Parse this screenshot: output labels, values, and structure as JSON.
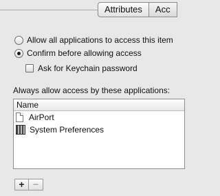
{
  "tabs": {
    "attributes": "Attributes",
    "access_control_partial": "Acc"
  },
  "options": {
    "allow_all": "Allow all applications to access this item",
    "confirm": "Confirm before allowing access",
    "ask_keychain_password": "Ask for Keychain password",
    "selected": "confirm"
  },
  "list": {
    "section_label": "Always allow access by these applications:",
    "column_header": "Name",
    "items": [
      {
        "name": "AirPort",
        "icon": "document-icon"
      },
      {
        "name": "System Preferences",
        "icon": "system-preferences-icon"
      }
    ]
  },
  "buttons": {
    "add": "+",
    "remove": "−"
  }
}
